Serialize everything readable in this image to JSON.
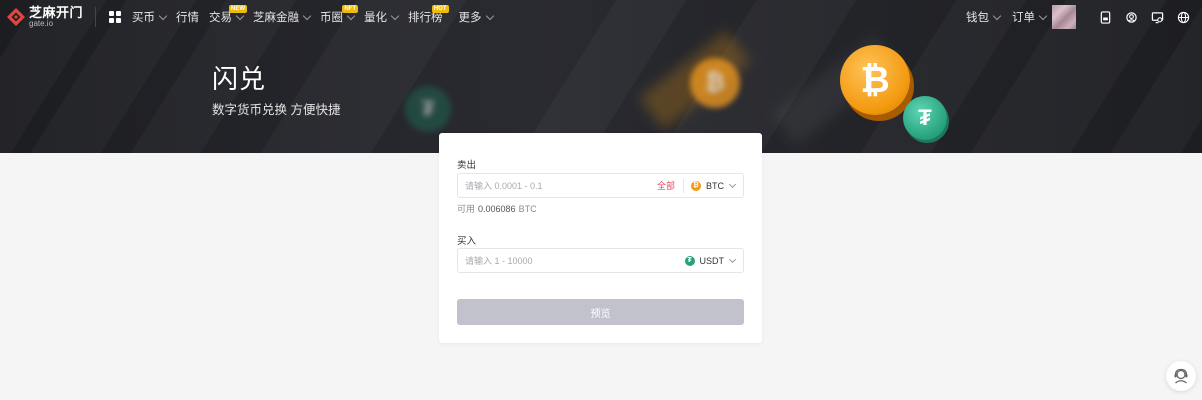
{
  "brand": {
    "name_cn": "芝麻开门",
    "name_en": "gate.io"
  },
  "nav": {
    "items": [
      {
        "label": "买币",
        "chevron": true,
        "badge": ""
      },
      {
        "label": "行情",
        "chevron": false,
        "badge": ""
      },
      {
        "label": "交易",
        "chevron": true,
        "badge": "NEW"
      },
      {
        "label": "芝麻金融",
        "chevron": true,
        "badge": ""
      },
      {
        "label": "币圈",
        "chevron": true,
        "badge": "NFT"
      },
      {
        "label": "量化",
        "chevron": true,
        "badge": ""
      },
      {
        "label": "排行榜",
        "chevron": false,
        "badge": "HOT"
      },
      {
        "label": "更多",
        "chevron": true,
        "badge": ""
      }
    ],
    "right": {
      "wallet": "钱包",
      "orders": "订单"
    }
  },
  "hero": {
    "title": "闪兑",
    "subtitle": "数字货币兑换 方便快捷"
  },
  "swap": {
    "sell_label": "卖出",
    "sell_placeholder": "请输入 0.0001 - 0.1",
    "all_label": "全部",
    "sell_coin": "BTC",
    "available_prefix": "可用",
    "available_amount": "0.006086",
    "available_unit": "BTC",
    "buy_label": "买入",
    "buy_placeholder": "请输入 1 - 10000",
    "buy_coin": "USDT",
    "preview_button": "预览"
  },
  "colors": {
    "accent_red": "#e84a5f",
    "btc": "#f39a10",
    "usdt": "#26a17b",
    "disabled_button": "#c1c2cc"
  }
}
